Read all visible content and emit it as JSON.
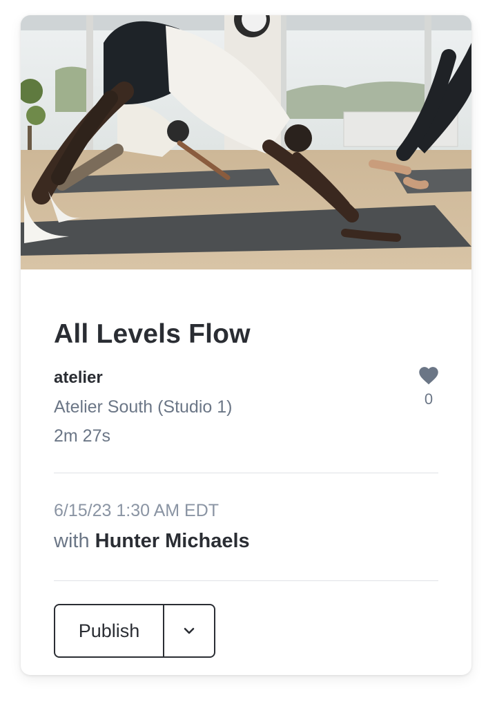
{
  "card": {
    "image": {
      "alt_subject": "group yoga class in downward dog pose"
    },
    "title": "All Levels Flow",
    "brand": "atelier",
    "location": "Atelier South (Studio 1)",
    "duration": "2m 27s",
    "likes": {
      "icon": "heart-icon",
      "count": "0"
    },
    "datetime": "6/15/23 1:30 AM EDT",
    "instructor": {
      "prefix": "with",
      "name": "Hunter Michaels"
    },
    "actions": {
      "publish_label": "Publish",
      "toggle_icon": "chevron-down-icon"
    }
  },
  "colors": {
    "heading": "#2a2d33",
    "muted": "#6b7686",
    "divider": "#dfe2e6"
  }
}
